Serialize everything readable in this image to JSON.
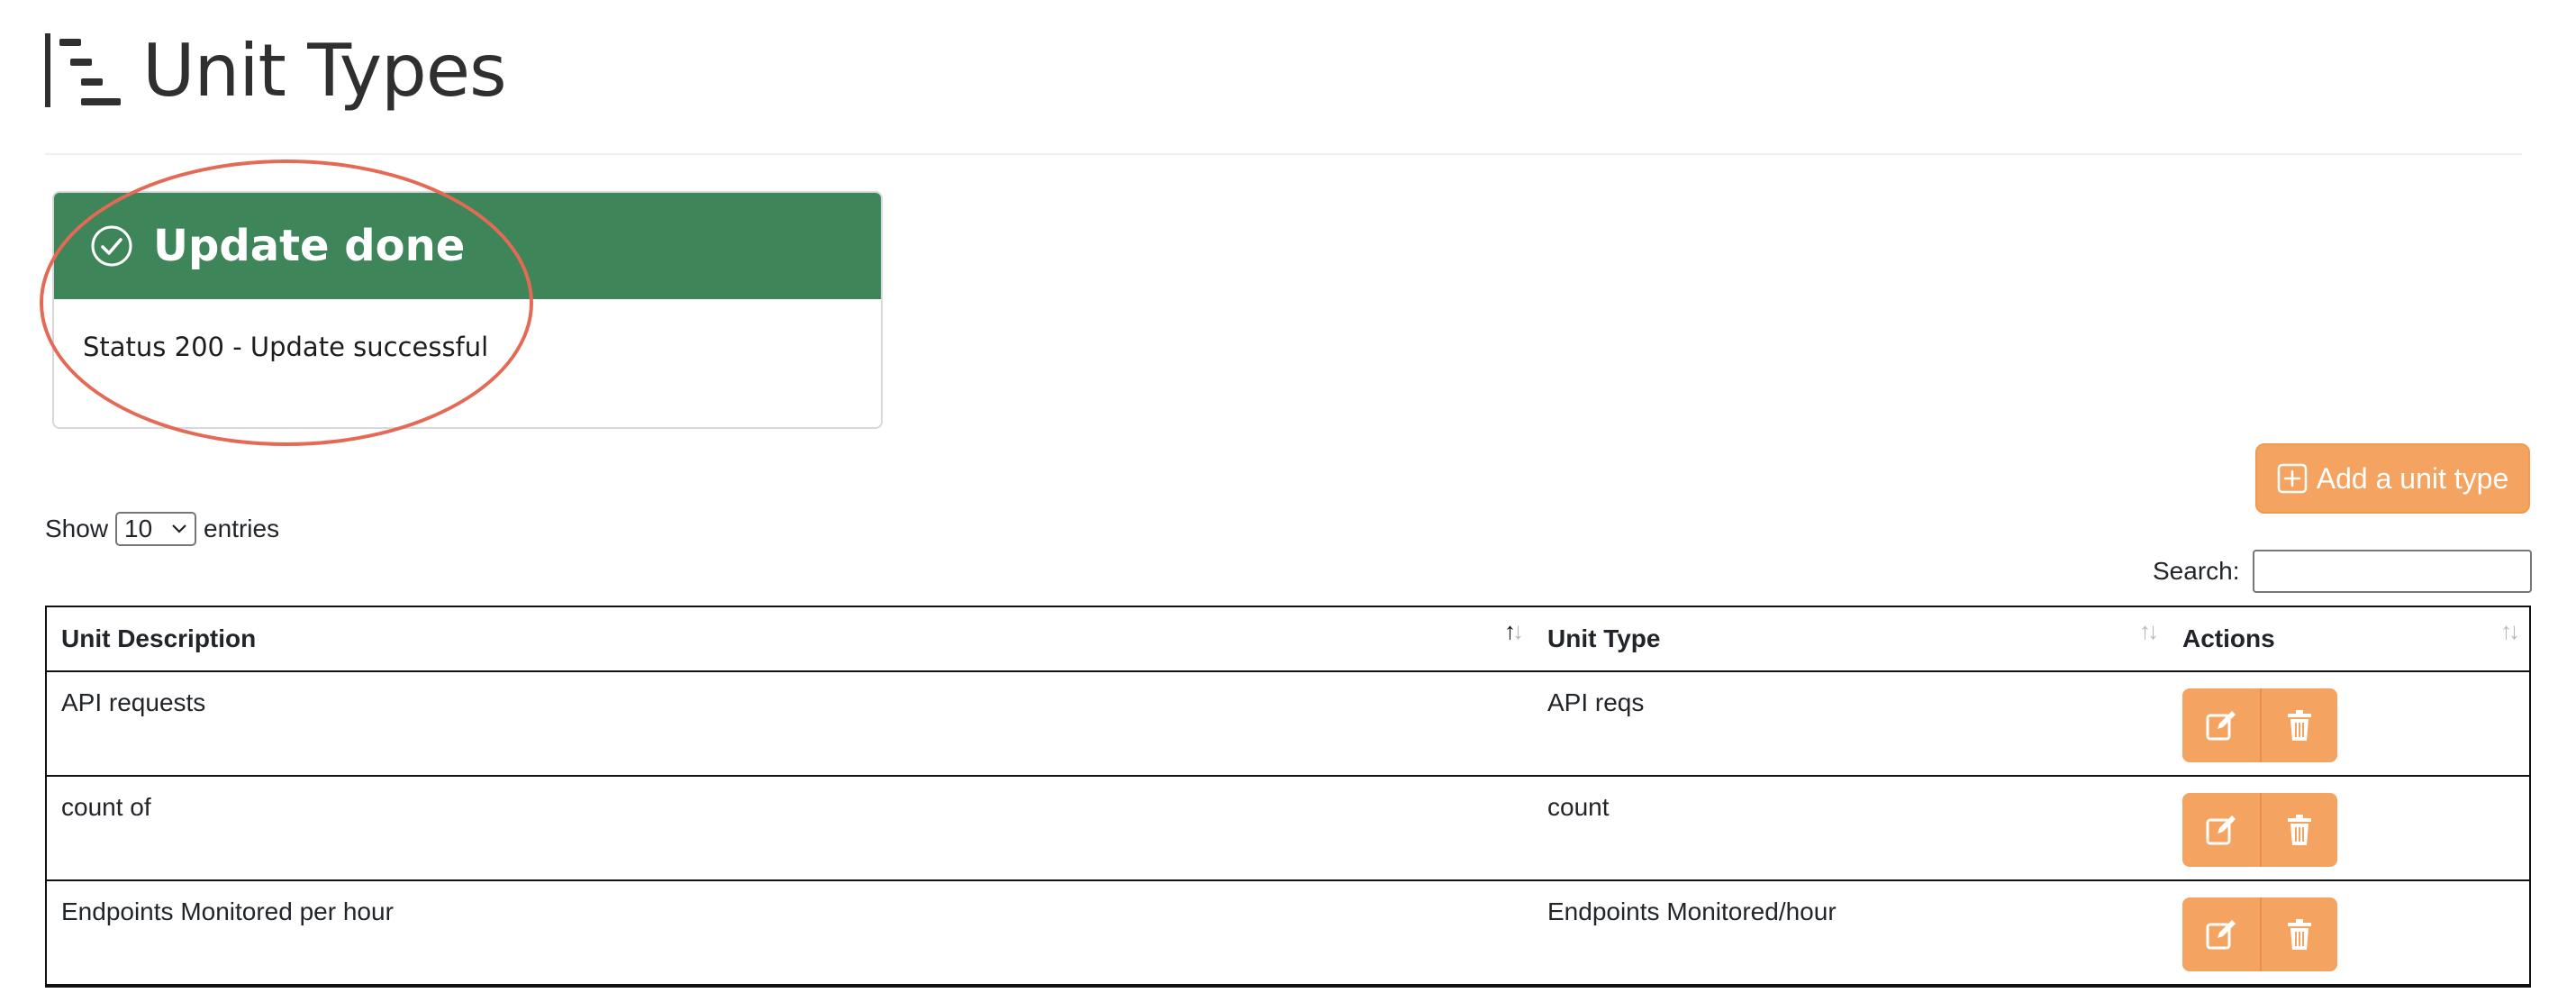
{
  "header": {
    "title": "Unit Types",
    "icon": "list-indent-icon"
  },
  "alert": {
    "title": "Update done",
    "message": "Status 200 - Update successful",
    "header_color": "#3e865a",
    "icon": "check-circle-icon"
  },
  "toolbar": {
    "add_label": "Add a unit type",
    "accent": "#f4a460"
  },
  "length": {
    "prefix": "Show",
    "value": "10",
    "suffix": "entries"
  },
  "search": {
    "label": "Search:",
    "value": ""
  },
  "table": {
    "columns": [
      "Unit Description",
      "Unit Type",
      "Actions"
    ],
    "rows": [
      {
        "description": "API requests",
        "type": "API reqs"
      },
      {
        "description": "count of",
        "type": "count"
      },
      {
        "description": "Endpoints Monitored per hour",
        "type": "Endpoints Monitored/hour"
      }
    ]
  }
}
